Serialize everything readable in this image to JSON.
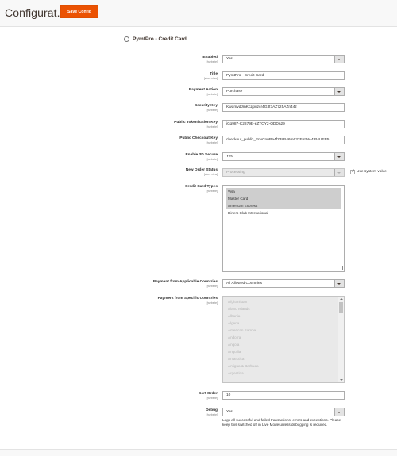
{
  "header": {
    "page_title": "Configurat...",
    "save_label": "Save Config"
  },
  "section": {
    "title": "PymtPro - Credit Card"
  },
  "fields": {
    "enabled": {
      "label": "Enabled",
      "scope": "[website]",
      "value": "Yes"
    },
    "title": {
      "label": "Title",
      "scope": "[store view]",
      "value": "PymtPro - Credit Card"
    },
    "payment_action": {
      "label": "Payment Action",
      "scope": "[website]",
      "value": "Purchase"
    },
    "security_key": {
      "label": "Security Key",
      "scope": "[website]",
      "value": "KwqmvdJmKcZpuzcr4G3f3AZ725AZn44z"
    },
    "public_tokenization_key": {
      "label": "Public Tokenization Key",
      "scope": "[website]",
      "value": "jCq987-C2879E-eZTCY2-QDDa29"
    },
    "public_checkout_key": {
      "label": "Public Checkout Key",
      "scope": "[website]",
      "value": "checkout_public_FnvCnuRa4f238B46m632FmWA4fP4UEP5"
    },
    "enable_3d_secure": {
      "label": "Enable 3D Secure",
      "scope": "[website]",
      "value": "Yes"
    },
    "new_order_status": {
      "label": "New Order Status",
      "scope": "[store view]",
      "value": "Processing",
      "use_system_value": "Use system value"
    },
    "credit_card_types": {
      "label": "Credit Card Types",
      "scope": "[website]",
      "options": [
        {
          "label": "Visa",
          "selected": true
        },
        {
          "label": "Master Card",
          "selected": true
        },
        {
          "label": "American Express",
          "selected": true
        },
        {
          "label": "Diners Club International",
          "selected": false
        }
      ]
    },
    "allowed_countries": {
      "label": "Payment from Applicable Countries",
      "scope": "[website]",
      "value": "All Allowed Countries"
    },
    "specific_countries": {
      "label": "Payment from Specific Countries",
      "scope": "[website]",
      "options": [
        "Afghanistan",
        "Åland Islands",
        "Albania",
        "Algeria",
        "American Samoa",
        "Andorra",
        "Angola",
        "Anguilla",
        "Antarctica",
        "Antigua & Barbuda",
        "Argentina"
      ]
    },
    "sort_order": {
      "label": "Sort Order",
      "scope": "[website]",
      "value": "10"
    },
    "debug": {
      "label": "Debug",
      "scope": "[website]",
      "value": "Yes",
      "note": "Logs all successful and failed transactions, errors and exceptions. Please keep this switched off in Live Mode unless debugging is required."
    }
  }
}
